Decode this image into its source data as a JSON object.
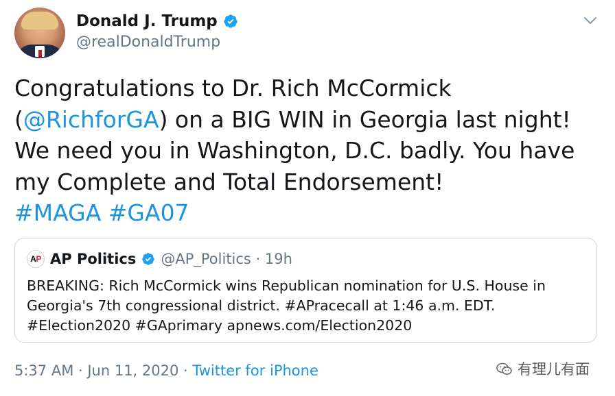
{
  "author": {
    "display_name": "Donald J. Trump",
    "handle": "@realDonaldTrump",
    "verified": true,
    "avatar": "profile-photo"
  },
  "tweet": {
    "line1": "Congratulations to Dr. Rich McCormick",
    "line2_open": "(",
    "line2_mention": "@RichforGA",
    "line2_rest": ") on a BIG WIN in Georgia last night!",
    "line3": "We need you in Washington, D.C. badly. You have",
    "line4": "my Complete and Total Endorsement!",
    "hashtag1": "#MAGA",
    "hashtag2": "#GA07"
  },
  "quoted": {
    "logo_text_a": "A",
    "logo_text_p": "P",
    "name": "AP Politics",
    "verified": true,
    "handle_time": "@AP_Politics · 19h",
    "body_line1": "BREAKING: Rich McCormick wins Republican nomination for U.S. House in",
    "body_line2": "Georgia's 7th congressional district. #APracecall at 1:46 a.m. EDT.",
    "body_line3": "#Election2020 #GAprimary apnews.com/Election2020"
  },
  "footer": {
    "timestamp": "5:37 AM · Jun 11, 2020 · ",
    "source": "Twitter for iPhone"
  },
  "watermark": {
    "text": "有理儿有面",
    "icon": "wechat-icon"
  },
  "colors": {
    "link": "#1b95e0",
    "secondary_text": "#657786",
    "verified": "#1da1f2",
    "border": "#ccd6dd"
  }
}
